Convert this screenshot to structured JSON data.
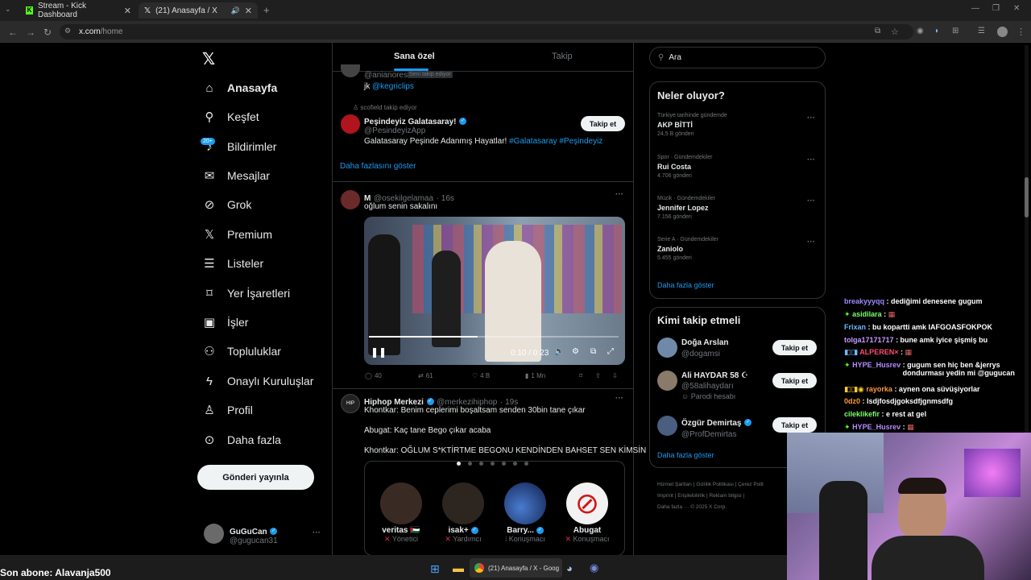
{
  "browser": {
    "tabs": [
      {
        "label": "Stream - Kick Dashboard",
        "icon": "kick-icon"
      },
      {
        "label": "(21) Anasayfa / X",
        "icon": "x-logo-icon"
      }
    ],
    "url": "x.com/home",
    "url_host": "x.com",
    "url_path": "/home"
  },
  "sidebar": {
    "items": [
      {
        "label": "Anasayfa",
        "icon": "home-icon"
      },
      {
        "label": "Keşfet",
        "icon": "search-icon"
      },
      {
        "label": "Bildirimler",
        "icon": "bell-icon",
        "badge": "20+"
      },
      {
        "label": "Mesajlar",
        "icon": "mail-icon"
      },
      {
        "label": "Grok",
        "icon": "grok-icon"
      },
      {
        "label": "Premium",
        "icon": "x-logo-icon"
      },
      {
        "label": "Listeler",
        "icon": "list-icon"
      },
      {
        "label": "Yer İşaretleri",
        "icon": "bookmark-icon"
      },
      {
        "label": "İşler",
        "icon": "briefcase-icon"
      },
      {
        "label": "Topluluklar",
        "icon": "people-icon"
      },
      {
        "label": "Onaylı Kuruluşlar",
        "icon": "lightning-icon"
      },
      {
        "label": "Profil",
        "icon": "person-icon"
      },
      {
        "label": "Daha fazla",
        "icon": "more-circle-icon"
      }
    ],
    "post_button": "Gönderi yayınla",
    "account": {
      "name": "GuGuCan",
      "handle": "@gugucan31"
    }
  },
  "feed": {
    "tabs": [
      "Sana özel",
      "Takip"
    ],
    "top_partial": {
      "handle": "@anianores",
      "follows_you": "Seni takip ediyor",
      "text": "jk",
      "link": "@kegriclips"
    },
    "who_to_follow_item": {
      "context": "scofield takip ediyor",
      "name": "Peşindeyiz Galatasaray!",
      "handle": "@PesindeyizApp",
      "bio_text": "Galatasaray Peşinde Adanmış Hayatlar!",
      "bio_tags": "#Galatasaray #Peşindeyiz",
      "follow": "Takip et"
    },
    "show_more": "Daha fazlasını göster",
    "post1": {
      "name": "M",
      "handle": "@osekilgelamaa",
      "time": "· 16s",
      "text": "oğlum senin sakalını",
      "video_time": "0:10 / 0:23",
      "replies": "40",
      "reposts": "61",
      "likes": "4 B",
      "views": "1 Mn"
    },
    "post2": {
      "name": "Hiphop Merkezi",
      "handle": "@merkezihiphop",
      "time": "· 19s",
      "lines": [
        "Khontkar: Benim ceplerimi boşaltsam senden 30bin tane çıkar",
        "Abugat: Kaç tane Bego çıkar acaba",
        "Khontkar: OĞLUM S*KTİRTME BEGONU KENDİNDEN BAHSET SEN KİMSİN"
      ],
      "speakers": [
        {
          "name": "veritas 🇵🇸",
          "role": "Yönetici"
        },
        {
          "name": "isak+",
          "role": "Yardımcı"
        },
        {
          "name": "Barry...",
          "role": "Konuşmacı"
        },
        {
          "name": "Abugat",
          "role": "Konuşmacı"
        }
      ]
    }
  },
  "right": {
    "search_placeholder": "Ara",
    "trends_title": "Neler oluyor?",
    "trends": [
      {
        "meta": "Türkiye tarihinde gündemde",
        "name": "AKP BİTTİ",
        "count": "24,5 B gönderi"
      },
      {
        "meta": "Spor · Gündemdekiler",
        "name": "Rui Costa",
        "count": "4.706 gönderi"
      },
      {
        "meta": "Müzik · Gündemdekiler",
        "name": "Jennifer Lopez",
        "count": "7.156 gönderi"
      },
      {
        "meta": "Serie A · Gündemdekiler",
        "name": "Zaniolo",
        "count": "5.455 gönderi"
      }
    ],
    "trends_more": "Daha fazla göster",
    "wtf_title": "Kimi takip etmeli",
    "wtf": [
      {
        "name": "Doğa Arslan",
        "handle": "@dogamsi",
        "extra": "",
        "follow": "Takip et"
      },
      {
        "name": "Ali HAYDAR 58 ☪",
        "handle": "@58alihaydarı",
        "extra": "Parodi hesabı",
        "follow": "Takip et"
      },
      {
        "name": "Özgür Demirtaş",
        "handle": "@ProfDemirtas",
        "extra": "",
        "follow": "Takip et"
      }
    ],
    "wtf_more": "Daha fazla göster",
    "footer": [
      "Hizmet Şartları",
      "Gizlilik Politikası",
      "Çerez Polit",
      "Imprint",
      "Erişilebilirlik",
      "Reklam bilgisi",
      "Daha fazla ···",
      "© 2025 X Corp."
    ]
  },
  "chat": [
    {
      "user": "breakyyyqq",
      "msg": ": dediğimi denesene gugum",
      "color": "#9b8cff"
    },
    {
      "user": "asidilara",
      "msg": ":",
      "color": "#7cff6b"
    },
    {
      "user": "Frixan",
      "msg": ": bu kopartti amk IAFGOASFOKPOK",
      "color": "#6fb6ff"
    },
    {
      "user": "tolga17171717",
      "msg": ": bune amk iyice şişmiş bu",
      "color": "#c59bff"
    },
    {
      "user": "ALPEREN×",
      "msg": ":",
      "color": "#ff4d6d"
    },
    {
      "user": "HYPE_Husrev",
      "msg": ": gugum sen hiç ben &jerrys dondurması yedin mi @gugucan",
      "color": "#b48cff"
    },
    {
      "user": "rayorka",
      "msg": ": aynen ona süvüşiyorlar",
      "color": "#ff9a3c"
    },
    {
      "user": "0dz0",
      "msg": ": lsdjfosdjgoksdfjgnmsdfg",
      "color": "#ff9a3c"
    },
    {
      "user": "cileklikefir",
      "msg": ": e rest at gel",
      "color": "#7cff6b"
    },
    {
      "user": "HYPE_Husrev",
      "msg": ":",
      "color": "#b48cff"
    }
  ],
  "stream": {
    "last_sub": "Son abone: Alavanja500"
  },
  "taskbar": {
    "active_app": "(21) Anasayfa / X - Goog"
  }
}
